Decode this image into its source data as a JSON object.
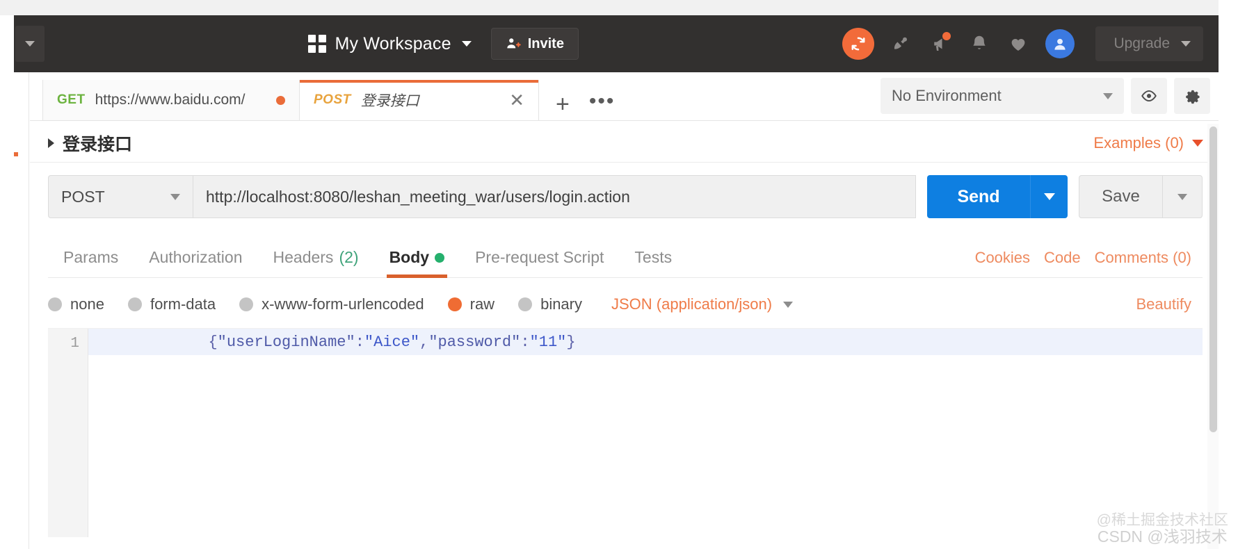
{
  "header": {
    "workspace_name": "My Workspace",
    "invite_label": "Invite",
    "upgrade_label": "Upgrade",
    "icons": {
      "grid": "grid-icon",
      "workspace_caret": "chevron-down-icon",
      "invite": "person-add-icon",
      "sync": "sync-icon",
      "satellite": "satellite-icon",
      "notifications_alt": "megaphone-icon",
      "bell": "bell-icon",
      "heart": "heart-icon",
      "avatar": "user-avatar-icon",
      "upgrade_caret": "chevron-down-icon"
    }
  },
  "tabs": [
    {
      "method": "GET",
      "title": "https://www.baidu.com/",
      "active": false,
      "unsaved": true
    },
    {
      "method": "POST",
      "title": "登录接口",
      "active": true,
      "unsaved": false
    }
  ],
  "tabbar": {
    "new_tab": "+",
    "more": "•••"
  },
  "environment": {
    "selected": "No Environment",
    "eye_icon": "eye-icon",
    "settings_icon": "gear-icon"
  },
  "request": {
    "name": "登录接口",
    "examples_label": "Examples (0)",
    "method": "POST",
    "url": "http://localhost:8080/leshan_meeting_war/users/login.action",
    "send_label": "Send",
    "save_label": "Save"
  },
  "section_tabs": [
    {
      "label": "Params",
      "active": false
    },
    {
      "label": "Authorization",
      "active": false
    },
    {
      "label": "Headers",
      "count": "(2)",
      "active": false
    },
    {
      "label": "Body",
      "active": true,
      "dot": true
    },
    {
      "label": "Pre-request Script",
      "active": false
    },
    {
      "label": "Tests",
      "active": false
    }
  ],
  "section_right": [
    {
      "label": "Cookies"
    },
    {
      "label": "Code"
    },
    {
      "label": "Comments (0)"
    }
  ],
  "body_options": [
    {
      "label": "none",
      "selected": false
    },
    {
      "label": "form-data",
      "selected": false
    },
    {
      "label": "x-www-form-urlencoded",
      "selected": false
    },
    {
      "label": "raw",
      "selected": true
    },
    {
      "label": "binary",
      "selected": false
    }
  ],
  "body": {
    "content_type": "JSON (application/json)",
    "beautify_label": "Beautify",
    "line_number": "1",
    "code_parts": {
      "open_brace": "{",
      "key1": "\"userLoginName\"",
      "colon1": ":",
      "val1": "\"Aice\"",
      "comma": ",",
      "key2": "\"password\"",
      "colon2": ":",
      "val2": "\"11\"",
      "close_brace": "}"
    },
    "raw_text": "{\"userLoginName\":\"Aice\",\"password\":\"11\"}"
  },
  "watermark": {
    "line1": "@稀土掘金技术社区",
    "line2": "CSDN @浅羽技术"
  },
  "colors": {
    "accent_orange": "#ea6c39",
    "send_blue": "#0e7fe1",
    "get_green": "#6cb33f",
    "post_orange": "#e8a33d",
    "header_dark": "#32302f"
  }
}
